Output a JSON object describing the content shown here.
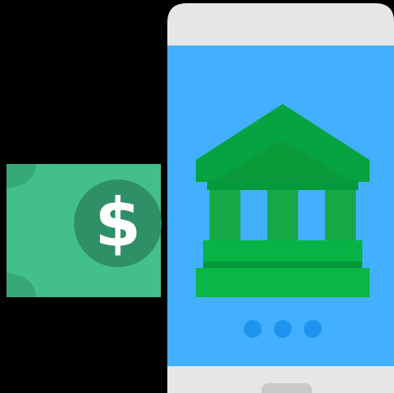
{
  "illustration": {
    "banknote": {
      "symbol": "$",
      "colors": {
        "note": "#42bf8c",
        "note_shade": "#37a877",
        "coin": "#2f8f66",
        "symbol": "#ffffff"
      }
    },
    "phone": {
      "colors": {
        "body": "#e6e6e4",
        "screen": "#43b0ff",
        "home_button": "#c9c9c9"
      },
      "indicator_dots": [
        {
          "state": "active",
          "color": "#1e94f0"
        },
        {
          "state": "inactive",
          "color": "#1e94f0"
        },
        {
          "state": "inactive",
          "color": "#1e94f0"
        }
      ]
    },
    "bank_icon": {
      "colors": {
        "roof": "#06a341",
        "roof_inner": "#0b9a3a",
        "columns": "#16a847",
        "base": "#07b344",
        "base_dark": "#03983a"
      }
    },
    "background": "#000000"
  }
}
